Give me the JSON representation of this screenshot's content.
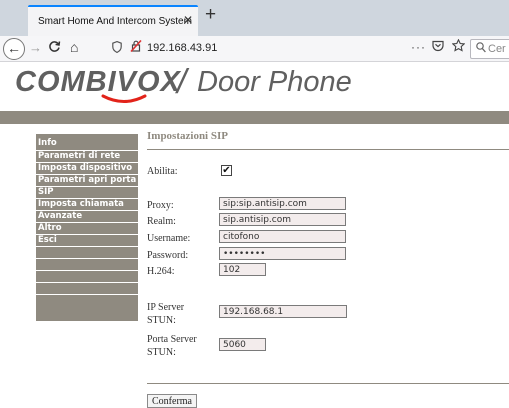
{
  "browser": {
    "tab_title": "Smart Home And Intercom System",
    "tab_close": "✕",
    "new_tab": "+",
    "back": "←",
    "forward": "→",
    "reload": "C",
    "home": "⌂",
    "url": "192.168.43.91",
    "more": "···",
    "search_placeholder": "Cer"
  },
  "logo": {
    "brand": "COMBIVOX",
    "separator": "/",
    "product": "Door Phone",
    "accent_color": "#e2231a"
  },
  "colors": {
    "menu_bg": "#8f8a80",
    "field_bg": "#f3ecec"
  },
  "sidebar": {
    "items": [
      "Info",
      "Parametri di rete",
      "Imposta dispositivo",
      "Parametri apri porta",
      "SIP",
      "Imposta chiamata",
      "Avanzate",
      "Altro",
      "Esci"
    ]
  },
  "form": {
    "title": "Impostazioni SIP",
    "enable_label": "Abilita:",
    "enable_checked": "✔",
    "proxy_label": "Proxy:",
    "proxy_value": "sip:sip.antisip.com",
    "realm_label": "Realm:",
    "realm_value": "sip.antisip.com",
    "username_label": "Username:",
    "username_value": "citofono",
    "password_label": "Password:",
    "password_value": "••••••••",
    "h264_label": "H.264:",
    "h264_value": "102",
    "stun_ip_label_1": "IP Server",
    "stun_ip_label_2": "STUN:",
    "stun_ip_value": "192.168.68.1",
    "stun_port_label_1": "Porta Server",
    "stun_port_label_2": "STUN:",
    "stun_port_value": "5060",
    "confirm_label": "Conferma"
  }
}
